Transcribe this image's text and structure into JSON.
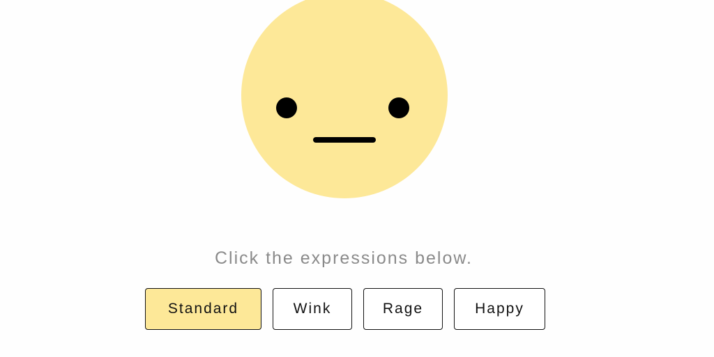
{
  "face": {
    "expression": "Standard",
    "color": "#fde898",
    "feature_color": "#000000"
  },
  "hint": {
    "text": "Click the expressions below."
  },
  "expressions": {
    "standard": "Standard",
    "wink": "Wink",
    "rage": "Rage",
    "happy": "Happy",
    "selected": "Standard",
    "selected_color": "#fde898"
  }
}
